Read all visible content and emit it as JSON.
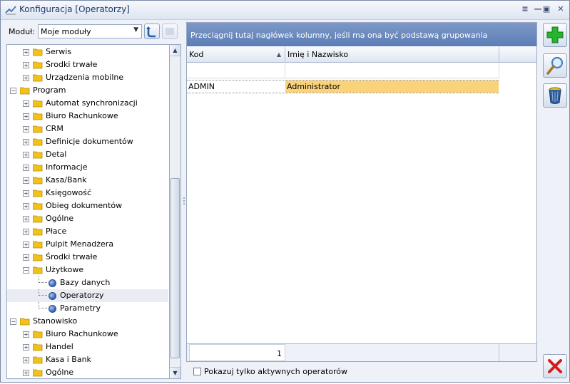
{
  "window": {
    "title": "Konfiguracja [Operatorzy]",
    "controls": [
      "≡",
      "—",
      "▣",
      "✕"
    ]
  },
  "module": {
    "label": "Moduł:",
    "selected": "Moje moduły"
  },
  "tree": [
    {
      "label": "Serwis",
      "level": 1,
      "kind": "folder",
      "exp": "+"
    },
    {
      "label": "Środki trwałe",
      "level": 1,
      "kind": "folder",
      "exp": "+"
    },
    {
      "label": "Urządzenia mobilne",
      "level": 1,
      "kind": "folder",
      "exp": "+"
    },
    {
      "label": "Program",
      "level": 0,
      "kind": "folder",
      "exp": "−"
    },
    {
      "label": "Automat synchronizacji",
      "level": 1,
      "kind": "folder",
      "exp": "+"
    },
    {
      "label": "Biuro Rachunkowe",
      "level": 1,
      "kind": "folder",
      "exp": "+"
    },
    {
      "label": "CRM",
      "level": 1,
      "kind": "folder",
      "exp": "+"
    },
    {
      "label": "Definicje dokumentów",
      "level": 1,
      "kind": "folder",
      "exp": "+"
    },
    {
      "label": "Detal",
      "level": 1,
      "kind": "folder",
      "exp": "+"
    },
    {
      "label": "Informacje",
      "level": 1,
      "kind": "folder",
      "exp": "+"
    },
    {
      "label": "Kasa/Bank",
      "level": 1,
      "kind": "folder",
      "exp": "+"
    },
    {
      "label": "Księgowość",
      "level": 1,
      "kind": "folder",
      "exp": "+"
    },
    {
      "label": "Obieg dokumentów",
      "level": 1,
      "kind": "folder",
      "exp": "+"
    },
    {
      "label": "Ogólne",
      "level": 1,
      "kind": "folder",
      "exp": "+"
    },
    {
      "label": "Płace",
      "level": 1,
      "kind": "folder",
      "exp": "+"
    },
    {
      "label": "Pulpit Menadżera",
      "level": 1,
      "kind": "folder",
      "exp": "+"
    },
    {
      "label": "Środki trwałe",
      "level": 1,
      "kind": "folder",
      "exp": "+"
    },
    {
      "label": "Użytkowe",
      "level": 1,
      "kind": "folder",
      "exp": "−"
    },
    {
      "label": "Bazy danych",
      "level": 2,
      "kind": "node"
    },
    {
      "label": "Operatorzy",
      "level": 2,
      "kind": "node",
      "selected": true
    },
    {
      "label": "Parametry",
      "level": 2,
      "kind": "node"
    },
    {
      "label": "Stanowisko",
      "level": 0,
      "kind": "folder",
      "exp": "−"
    },
    {
      "label": "Biuro Rachunkowe",
      "level": 1,
      "kind": "folder",
      "exp": "+"
    },
    {
      "label": "Handel",
      "level": 1,
      "kind": "folder",
      "exp": "+"
    },
    {
      "label": "Kasa i Bank",
      "level": 1,
      "kind": "folder",
      "exp": "+"
    },
    {
      "label": "Ogólne",
      "level": 1,
      "kind": "folder",
      "exp": "+"
    }
  ],
  "grid": {
    "group_hint": "Przeciągnij tutaj nagłówek kolumny, jeśli ma ona być podstawą grupowania",
    "columns": [
      "Kod",
      "Imię i Nazwisko"
    ],
    "rows": [
      {
        "kod": "ADMIN",
        "name": "Administrator"
      }
    ],
    "count": "1"
  },
  "options": {
    "active_only_label": "Pokazuj tylko aktywnych operatorów"
  },
  "colors": {
    "header_blue": "#5b7db6",
    "highlight": "#fad27a",
    "folder": "#f2c21b"
  },
  "icons": {
    "refresh": "refresh-icon",
    "add": "plus-icon",
    "edit": "magnifier-icon",
    "delete": "trash-icon",
    "close": "close-icon"
  }
}
